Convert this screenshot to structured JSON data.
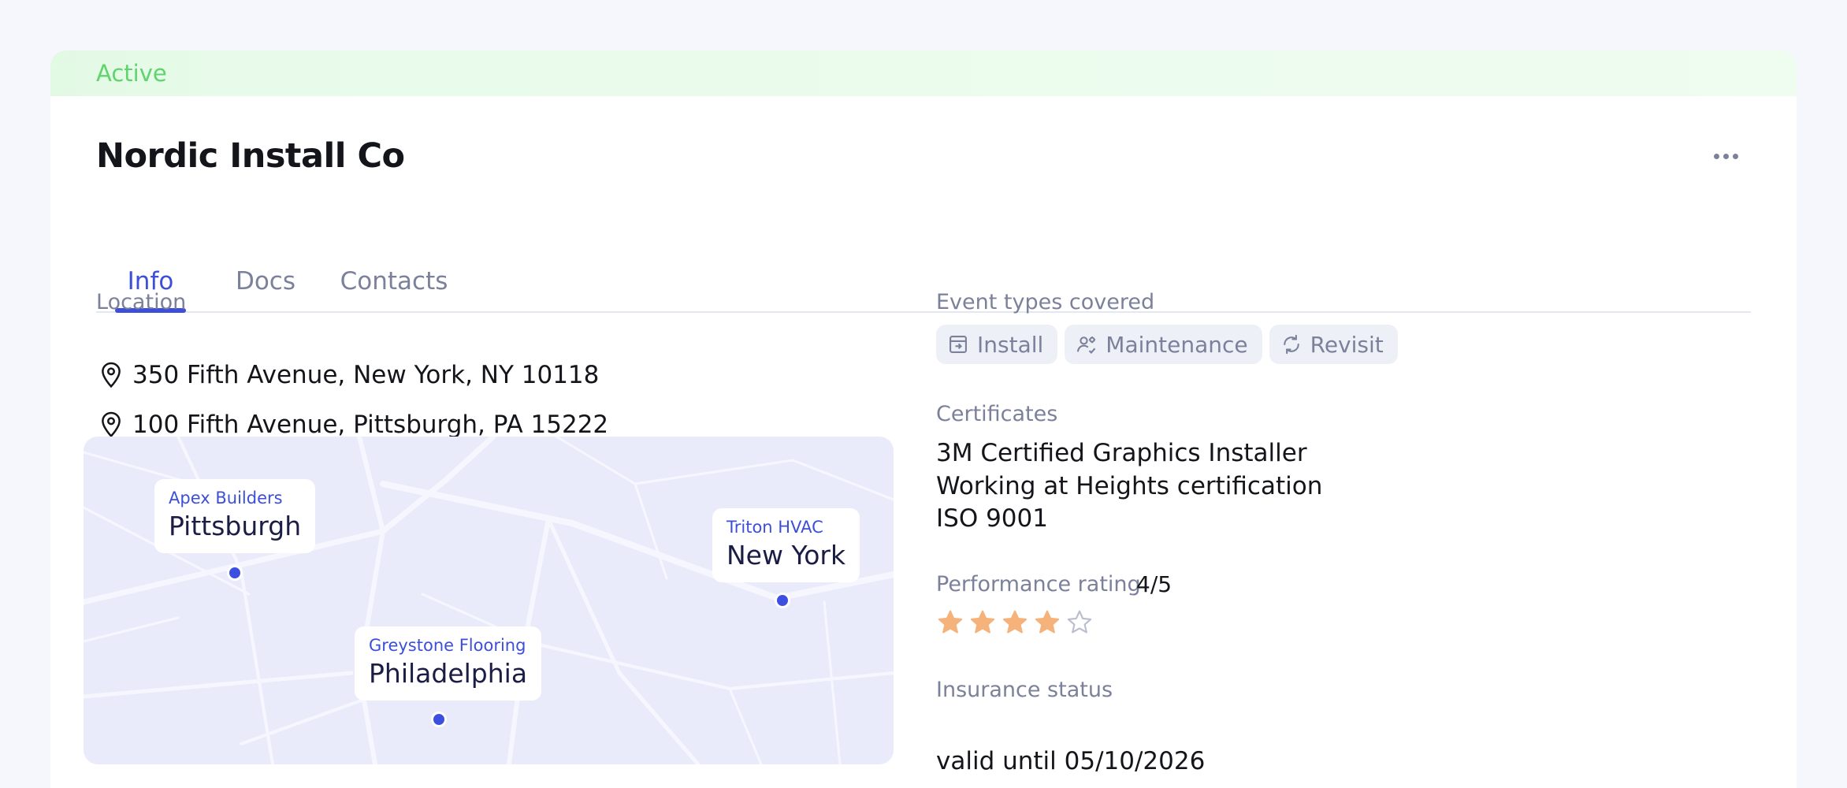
{
  "status": {
    "label": "Active",
    "color": "#5fd46e"
  },
  "vendor": {
    "name": "Nordic Install Co"
  },
  "tabs": [
    {
      "label": "Info",
      "active": true
    },
    {
      "label": "Docs",
      "active": false
    },
    {
      "label": "Contacts",
      "active": false
    }
  ],
  "location": {
    "label": "Location",
    "addresses": [
      "350 Fifth Avenue, New York, NY 10118",
      "100 Fifth Avenue, Pittsburgh, PA 15222"
    ]
  },
  "map": {
    "markers": [
      {
        "company": "Apex Builders",
        "city": "Pittsburgh"
      },
      {
        "company": "Triton HVAC",
        "city": "New York"
      },
      {
        "company": "Greystone Flooring",
        "city": "Philadelphia"
      }
    ]
  },
  "event_types": {
    "label": "Event types covered",
    "items": [
      {
        "label": "Install",
        "icon": "install-icon"
      },
      {
        "label": "Maintenance",
        "icon": "maintenance-icon"
      },
      {
        "label": "Revisit",
        "icon": "revisit-icon"
      }
    ]
  },
  "certificates": {
    "label": "Certificates",
    "items": [
      "3M Certified Graphics Installer",
      "Working at Heights certification",
      "ISO 9001"
    ]
  },
  "performance": {
    "label": "Performance rating",
    "value_text": "4/5",
    "rating": 4,
    "max": 5,
    "star_color": "#f5b27a"
  },
  "insurance": {
    "label": "Insurance status",
    "value": "valid until 05/10/2026"
  },
  "colors": {
    "accent": "#3d4fd8",
    "muted": "#7b819a",
    "map_background": "#e9ebfa"
  }
}
